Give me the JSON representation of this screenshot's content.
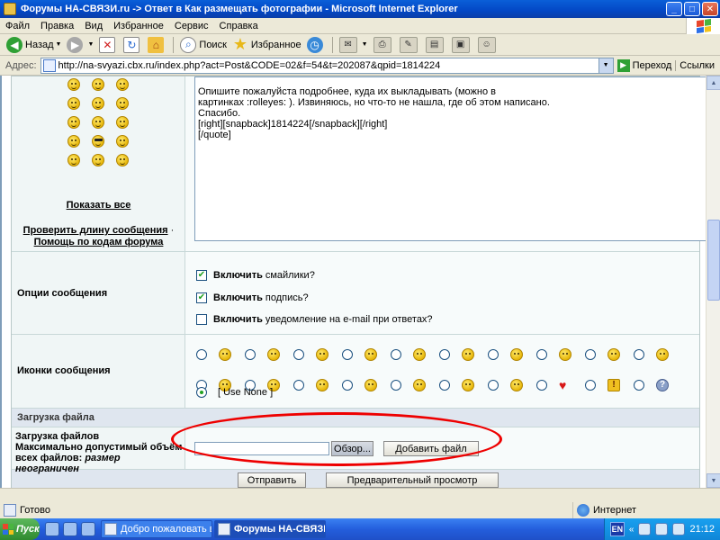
{
  "window": {
    "title": "Форумы НА-СВЯЗИ.ru -> Ответ в Как размещать фотографии - Microsoft Internet Explorer"
  },
  "menu": [
    "Файл",
    "Правка",
    "Вид",
    "Избранное",
    "Сервис",
    "Справка"
  ],
  "toolbar": {
    "back": "Назад",
    "search": "Поиск",
    "favorites": "Избранное"
  },
  "address": {
    "label": "Адрес:",
    "url": "http://na-svyazi.cbx.ru/index.php?act=Post&CODE=02&f=54&t=202087&qpid=1814224",
    "go": "Переход",
    "links": "Ссылки"
  },
  "smilies_panel": {
    "show_all": "Показать все",
    "check_length": "Проверить длину сообщения",
    "dot": "·",
    "help_codes": "Помощь по кодам форума"
  },
  "message": {
    "lines": [
      "Опишите пожалуйста подробнее, куда их выкладывать (можно в",
      "картинках :rolleyes: ). Извиняюсь, но что-то не нашла, где об этом написано.",
      "Спасибо.",
      "[right][snapback]1814224[/snapback][/right]",
      "[/quote]"
    ]
  },
  "options": {
    "label": "Опции сообщения",
    "items": [
      {
        "bold": "Включить",
        "rest": "смайлики?",
        "checked": true
      },
      {
        "bold": "Включить",
        "rest": "подпись?",
        "checked": true
      },
      {
        "bold": "Включить",
        "rest": "уведомление на e-mail при ответах?",
        "checked": false
      }
    ]
  },
  "message_icons": {
    "label": "Иконки сообщения",
    "use_none": "[ Use None ]"
  },
  "upload": {
    "section": "Загрузка файла",
    "label_line1": "Загрузка файлов",
    "label_line2": "Максимально допустимый объём",
    "label_line3_bold": "всех файлов:",
    "label_line3_italic": "размер неограничен",
    "browse": "Обзор...",
    "add_file": "Добавить файл"
  },
  "actions": {
    "submit": "Отправить",
    "preview": "Предварительный просмотр"
  },
  "status": {
    "text": "Готово",
    "zone": "Интернет"
  },
  "taskbar": {
    "start": "Пуск",
    "tasks": [
      "Добро пожаловать в ли...",
      "Форумы НА-СВЯЗИ..."
    ],
    "lang": "EN",
    "time": "21:12"
  }
}
